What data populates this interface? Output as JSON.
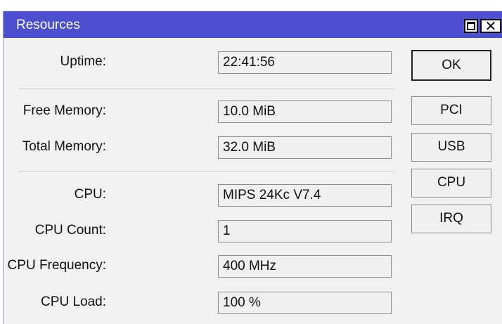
{
  "window": {
    "title": "Resources"
  },
  "fields": {
    "uptime": {
      "label": "Uptime:",
      "value": "22:41:56"
    },
    "free_memory": {
      "label": "Free Memory:",
      "value": "10.0 MiB"
    },
    "total_memory": {
      "label": "Total Memory:",
      "value": "32.0 MiB"
    },
    "cpu": {
      "label": "CPU:",
      "value": "MIPS 24Kc V7.4"
    },
    "cpu_count": {
      "label": "CPU Count:",
      "value": "1"
    },
    "cpu_frequency": {
      "label": "CPU Frequency:",
      "value": "400 MHz"
    },
    "cpu_load": {
      "label": "CPU Load:",
      "value": "100 %"
    }
  },
  "buttons": {
    "ok": "OK",
    "pci": "PCI",
    "usb": "USB",
    "cpu": "CPU",
    "irq": "IRQ"
  },
  "icons": {
    "maximize": "maximize-icon",
    "close": "close-icon"
  },
  "colors": {
    "titlebar": "#4c4fd0",
    "window_bg": "#f1f1f1"
  }
}
